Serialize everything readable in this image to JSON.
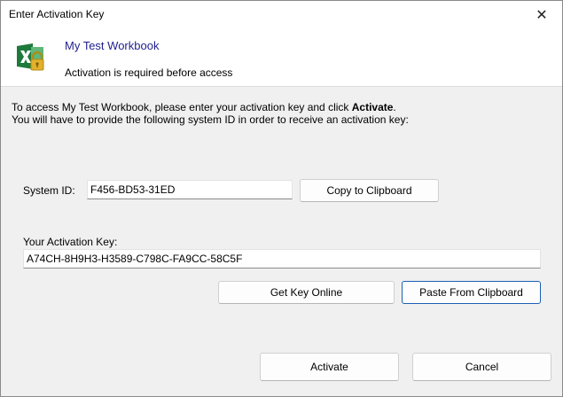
{
  "window": {
    "title": "Enter Activation Key",
    "close_glyph": "✕"
  },
  "header": {
    "title": "My Test Workbook",
    "subtitle": "Activation is required before access",
    "icon": "excel-lock-icon"
  },
  "intro": {
    "line1_prefix": "To access My Test Workbook, please enter your activation key and click ",
    "line1_bold": "Activate",
    "line1_suffix": ".",
    "line2": "You will have to provide the following system ID in order to receive an activation key:"
  },
  "system_id": {
    "label": "System ID:",
    "value": "F456-BD53-31ED",
    "copy_button": "Copy to Clipboard"
  },
  "activation": {
    "label": "Your Activation Key:",
    "value": "A74CH-8H9H3-H3589-C798C-FA9CC-58C5F",
    "get_key_button": "Get Key Online",
    "paste_button": "Paste From Clipboard"
  },
  "footer": {
    "activate_button": "Activate",
    "cancel_button": "Cancel"
  },
  "colors": {
    "header_title": "#1f1f8f",
    "focus_border": "#1a5fb4",
    "excel_green": "#1e7a3c",
    "lock_gold": "#e2b12c"
  }
}
